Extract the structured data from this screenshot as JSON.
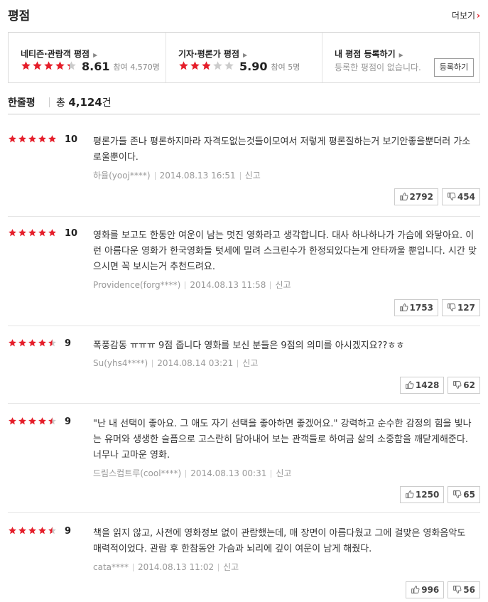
{
  "header": {
    "title": "평점",
    "more_label": "더보기"
  },
  "summary": {
    "netizen": {
      "label": "네티즌·관람객 평점",
      "score": "8.61",
      "participants": "참여 4,570명",
      "rating": 4.3
    },
    "critic": {
      "label": "기자·평론가 평점",
      "score": "5.90",
      "participants": "참여 5명",
      "rating": 2.95
    },
    "mine": {
      "label": "내 평점 등록하기",
      "desc": "등록한 평점이 없습니다.",
      "button": "등록하기"
    }
  },
  "oneline": {
    "label": "한줄평",
    "total_prefix": "총",
    "total_count": "4,124",
    "total_suffix": "건"
  },
  "colors": {
    "accent": "#e51e2a",
    "star_empty": "#cccccc"
  },
  "reviews": [
    {
      "score": "10",
      "rating": 5,
      "text": "평론가들 존나 평론하지마라 자격도없는것들이모여서 저렇게 평론질하는거 보기안좋을뿐더러 가소로울뿐이다.",
      "author": "하율(yooj****)",
      "date": "2014.08.13 16:51",
      "report": "신고",
      "likes": "2792",
      "dislikes": "454"
    },
    {
      "score": "10",
      "rating": 5,
      "text": "영화를 보고도 한동안 여운이 남는 멋진 영화라고 생각합니다. 대사 하나하나가 가슴에 와닿아요. 이런 아름다운 영화가 한국영화들 텃세에 밀려 스크린수가 한정되있다는게 안타까울 뿐입니다. 시간 맞으시면 꼭 보시는거 추천드려요.",
      "author": "Providence(forg****)",
      "date": "2014.08.13 11:58",
      "report": "신고",
      "likes": "1753",
      "dislikes": "127"
    },
    {
      "score": "9",
      "rating": 4.5,
      "text": "폭풍감동 ㅠㅠㅠ 9점 줍니다 영화를 보신 분들은 9점의 의미를 아시겠지요??ㅎㅎ",
      "author": "Su(yhs4****)",
      "date": "2014.08.14 03:21",
      "report": "신고",
      "likes": "1428",
      "dislikes": "62"
    },
    {
      "score": "9",
      "rating": 4.5,
      "text": "\"난 내 선택이 좋아요. 그 애도 자기 선택을 좋아하면 좋겠어요.\" 강력하고 순수한 감정의 힘을 빛나는 유머와 생생한 슬픔으로 고스란히 담아내어 보는 관객들로 하여금 삶의 소중함을 깨닫게해준다. 너무나 고마운 영화.",
      "author": "드림스컴트루(cool****)",
      "date": "2014.08.13 00:31",
      "report": "신고",
      "likes": "1250",
      "dislikes": "65"
    },
    {
      "score": "9",
      "rating": 4.5,
      "text": "책을 읽지 않고, 사전에 영화정보 없이 관람했는데, 매 장면이 아름다웠고 그에 걸맞은 영화음악도 매력적이었다. 관람 후 한참동안 가슴과 뇌리에 깊이 여운이 남게 해줬다.",
      "author": "cata****",
      "date": "2014.08.13 11:02",
      "report": "신고",
      "likes": "996",
      "dislikes": "56"
    }
  ]
}
